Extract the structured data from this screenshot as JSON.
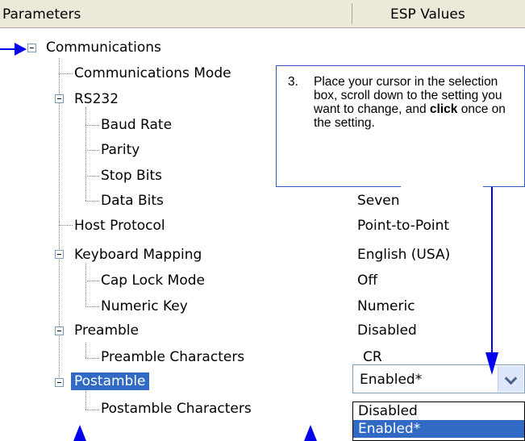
{
  "header": {
    "col_params": "Parameters",
    "col_values": "ESP Values"
  },
  "rows": [
    {
      "label": "Communications",
      "value": ""
    },
    {
      "label": "Communications Mode",
      "value": ""
    },
    {
      "label": "RS232",
      "value": ""
    },
    {
      "label": "Baud Rate",
      "value": ""
    },
    {
      "label": "Parity",
      "value": ""
    },
    {
      "label": "Stop Bits",
      "value": ""
    },
    {
      "label": "Data Bits",
      "value": "Seven"
    },
    {
      "label": "Host Protocol",
      "value": "Point-to-Point"
    },
    {
      "label": "Keyboard Mapping",
      "value": "English (USA)"
    },
    {
      "label": "Cap Lock Mode",
      "value": "Off"
    },
    {
      "label": "Numeric Key",
      "value": "Numeric"
    },
    {
      "label": "Preamble",
      "value": "Disabled"
    },
    {
      "label": "Preamble Characters",
      "value": "CR"
    },
    {
      "label": "Postamble",
      "value": ""
    },
    {
      "label": "Postamble Characters",
      "value": ""
    }
  ],
  "combo": {
    "value": "Enabled*"
  },
  "dropdown": {
    "options": [
      "Disabled",
      "Enabled*"
    ],
    "selected_index": 1
  },
  "callout": {
    "number": "3.",
    "text_before": "Place your cursor in the selection box, scroll down to the setting you want to change, and ",
    "bold": "click",
    "text_after": " once on the setting."
  },
  "colors": {
    "accent": "#316ac5",
    "arrow": "#0000ee",
    "callout_border": "#3355cc"
  }
}
